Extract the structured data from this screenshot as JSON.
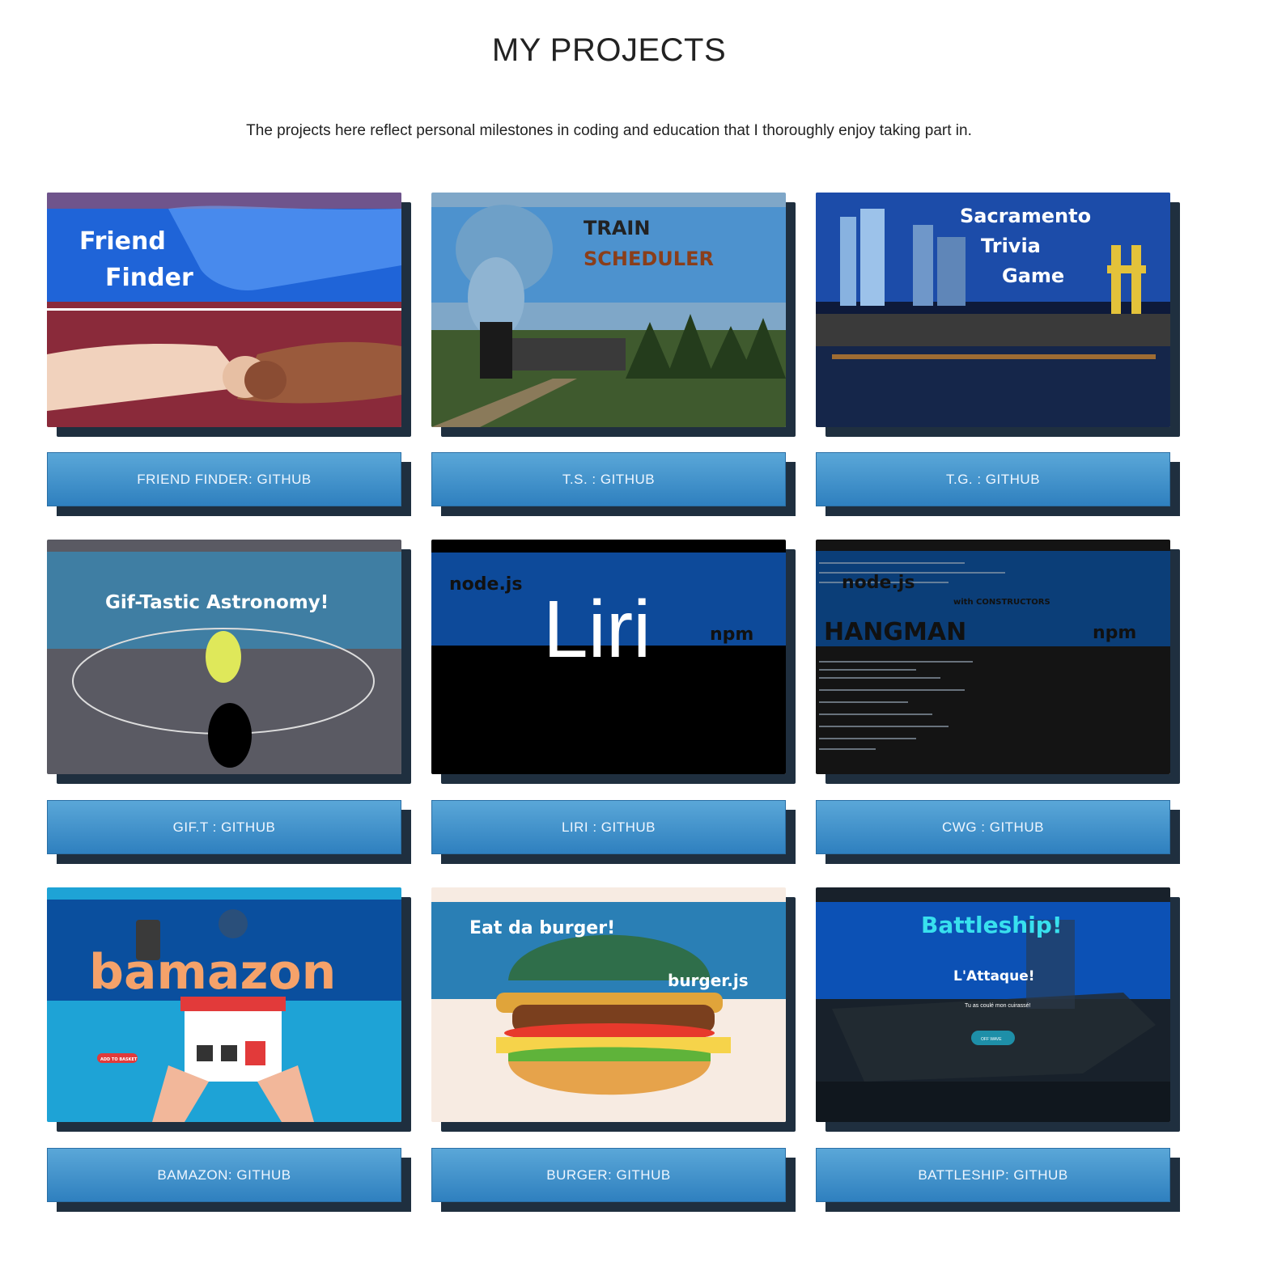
{
  "header": {
    "title_prefix": "MY",
    "title_main": "PROJECTS",
    "intro": "The projects here reflect personal milestones in coding and education that I thoroughly enjoy taking part in."
  },
  "projects": [
    {
      "image_text": [
        "Friend",
        "Finder"
      ],
      "button": "FRIEND FINDER: GITHUB"
    },
    {
      "image_text": [
        "TRAIN",
        "SCHEDULER"
      ],
      "button": "T.S. : GITHUB"
    },
    {
      "image_text": [
        "Sacramento",
        "Trivia",
        "Game"
      ],
      "button": "T.G. : GITHUB"
    },
    {
      "image_text": [
        "Gif-Tastic Astronomy!"
      ],
      "button": "GIF.T : GITHUB"
    },
    {
      "image_text": [
        "node.js",
        "Liri",
        "npm"
      ],
      "button": "LIRI : GITHUB"
    },
    {
      "image_text": [
        "node.js",
        "with CONSTRUCTORS",
        "HANGMAN",
        "npm"
      ],
      "button": "CWG : GITHUB"
    },
    {
      "image_text": [
        "bamazon",
        "ADD TO BASKET"
      ],
      "button": "BAMAZON: GITHUB"
    },
    {
      "image_text": [
        "Eat da burger!",
        "burger.js"
      ],
      "button": "BURGER: GITHUB"
    },
    {
      "image_text": [
        "Battleship!",
        "L'Attaque!",
        "Tu as coulé mon cuirassé!",
        "OFF WAVE"
      ],
      "button": "BATTLESHIP: GITHUB"
    }
  ]
}
